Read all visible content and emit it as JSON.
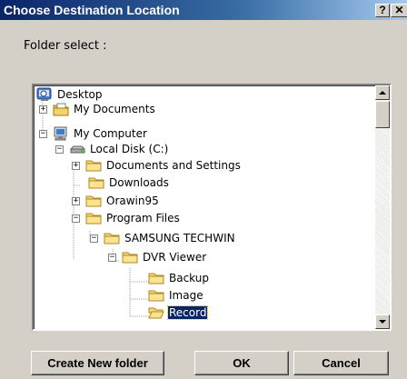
{
  "window": {
    "title": "Choose Destination Location",
    "help_label": "?",
    "close_label": "✕"
  },
  "dialog": {
    "folder_select_label": "Folder select :"
  },
  "tree": {
    "items": [
      {
        "label": "Desktop",
        "icon": "desktop-icon",
        "expander": ""
      },
      {
        "label": "My Documents",
        "icon": "my-documents-icon",
        "expander": "+"
      },
      {
        "label": "My Computer",
        "icon": "my-computer-icon",
        "expander": "−"
      },
      {
        "label": "Local Disk (C:)",
        "icon": "local-disk-icon",
        "expander": "−"
      },
      {
        "label": "Documents and Settings",
        "icon": "folder-icon",
        "expander": "+"
      },
      {
        "label": "Downloads",
        "icon": "folder-icon",
        "expander": ""
      },
      {
        "label": "Orawin95",
        "icon": "folder-icon",
        "expander": "+"
      },
      {
        "label": "Program Files",
        "icon": "folder-icon",
        "expander": "−"
      },
      {
        "label": "SAMSUNG TECHWIN",
        "icon": "folder-icon",
        "expander": "−"
      },
      {
        "label": "DVR Viewer",
        "icon": "folder-icon",
        "expander": "−"
      },
      {
        "label": "Backup",
        "icon": "folder-icon",
        "expander": ""
      },
      {
        "label": "Image",
        "icon": "folder-icon",
        "expander": ""
      },
      {
        "label": "Record",
        "icon": "open-folder-icon",
        "expander": "",
        "selected": true
      }
    ]
  },
  "buttons": {
    "create_new_folder": "Create New folder",
    "ok": "OK",
    "cancel": "Cancel"
  }
}
